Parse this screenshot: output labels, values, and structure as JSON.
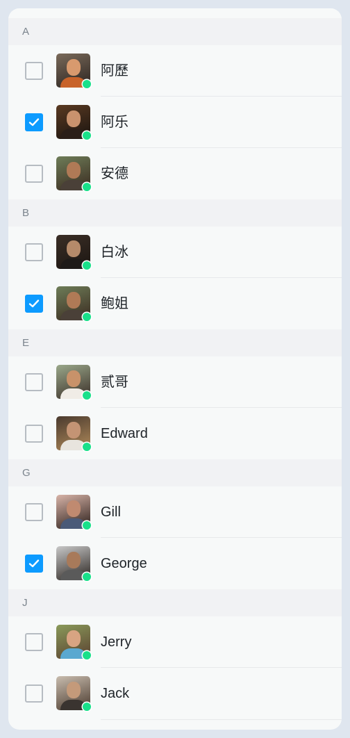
{
  "contacts": {
    "accent_color": "#0d9bff",
    "online_color": "#19e08a",
    "sections": [
      {
        "letter": "A",
        "items": [
          {
            "name": "阿歷",
            "checked": false,
            "online": true,
            "avatar": "woman-glasses-photo",
            "avatar_colors": [
              "#7a6a5a",
              "#2b2420",
              "#d89a6e",
              "#c8632a"
            ]
          },
          {
            "name": "阿乐",
            "checked": true,
            "online": true,
            "avatar": "woman-hat-photo",
            "avatar_colors": [
              "#5a3a22",
              "#1a1410",
              "#c9926e",
              "#2a1e18"
            ]
          },
          {
            "name": "安德",
            "checked": false,
            "online": true,
            "avatar": "smiling-man-photo",
            "avatar_colors": [
              "#6e7d58",
              "#3a2a20",
              "#b07a56",
              "#4a4038"
            ]
          }
        ]
      },
      {
        "letter": "B",
        "items": [
          {
            "name": "白冰",
            "checked": false,
            "online": true,
            "avatar": "man-leather-jacket-photo",
            "avatar_colors": [
              "#3a2e26",
              "#1c1612",
              "#b58a6a",
              "#1e1a18"
            ]
          },
          {
            "name": "鲍姐",
            "checked": true,
            "online": true,
            "avatar": "smiling-man-photo",
            "avatar_colors": [
              "#6e7d58",
              "#3a2a20",
              "#b07a56",
              "#4a4038"
            ]
          }
        ]
      },
      {
        "letter": "E",
        "items": [
          {
            "name": "贰哥",
            "checked": false,
            "online": true,
            "avatar": "man-cap-photo",
            "avatar_colors": [
              "#9aa88a",
              "#3a2e28",
              "#c8926a",
              "#f0ece6"
            ]
          },
          {
            "name": "Edward",
            "checked": false,
            "online": true,
            "avatar": "blond-man-photo",
            "avatar_colors": [
              "#4a3a2e",
              "#b08a5a",
              "#c49474",
              "#e8e4de"
            ]
          }
        ]
      },
      {
        "letter": "G",
        "items": [
          {
            "name": "Gill",
            "checked": false,
            "online": true,
            "avatar": "woman-beach-photo",
            "avatar_colors": [
              "#d8b4a8",
              "#2a1e1a",
              "#c08a70",
              "#4a5a78"
            ]
          },
          {
            "name": "George",
            "checked": true,
            "online": true,
            "avatar": "man-vest-photo",
            "avatar_colors": [
              "#c8c8c8",
              "#2a2420",
              "#a87a5a",
              "#5a5a5a"
            ]
          }
        ]
      },
      {
        "letter": "J",
        "items": [
          {
            "name": "Jerry",
            "checked": false,
            "online": true,
            "avatar": "boy-striped-shirt-photo",
            "avatar_colors": [
              "#8a9a5a",
              "#5a4030",
              "#d8a482",
              "#5aa8d0"
            ]
          },
          {
            "name": "Jack",
            "checked": false,
            "online": true,
            "avatar": "man-vest-photo",
            "avatar_colors": [
              "#c8bcae",
              "#4a3a2e",
              "#c49a7a",
              "#3a3430"
            ]
          }
        ]
      }
    ]
  }
}
